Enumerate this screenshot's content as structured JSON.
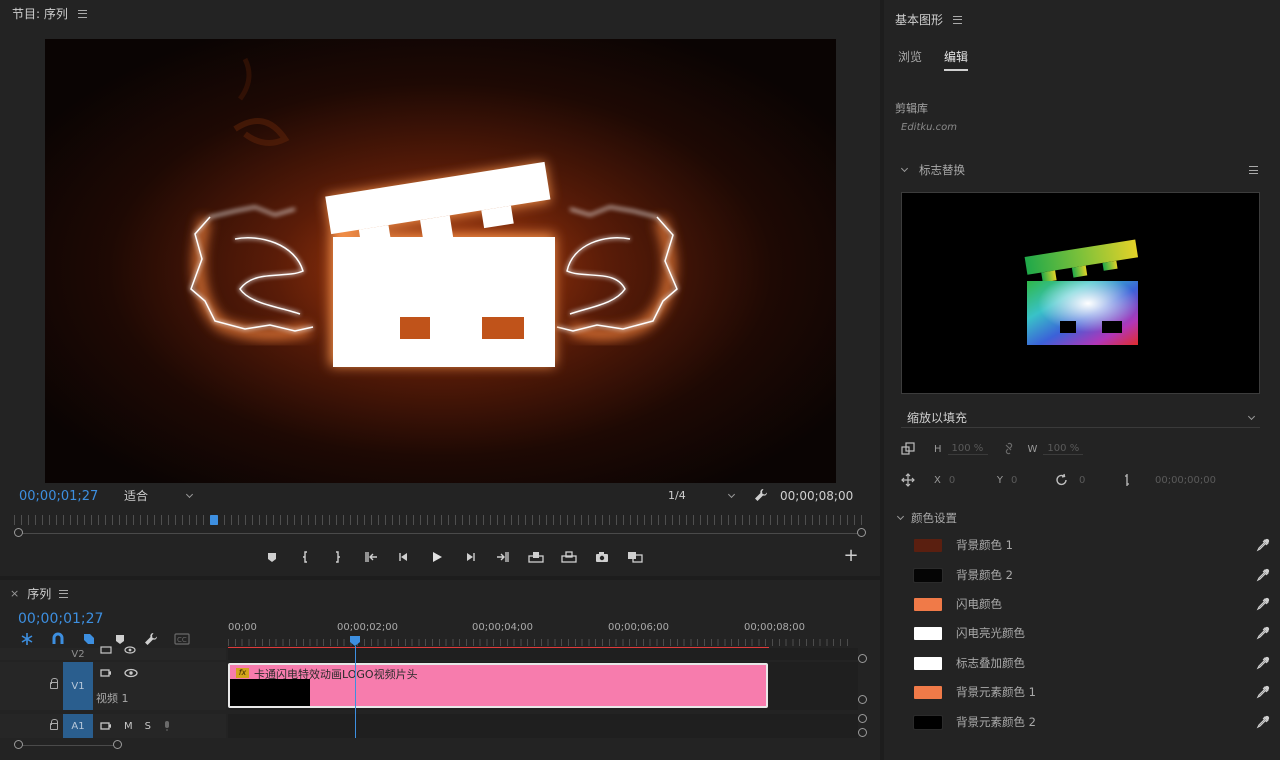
{
  "program": {
    "title": "节目: 序列",
    "timecode": "00;00;01;27",
    "fit": "适合",
    "resolution": "1/4",
    "duration": "00;00;08;00",
    "playhead_progress": 0.235
  },
  "timeline": {
    "title": "序列",
    "close": "×",
    "timecode": "00;00;01;27",
    "ruler": [
      "00;00",
      "00;00;02;00",
      "00;00;04;00",
      "00;00;06;00",
      "00;00;08;00"
    ],
    "tracks": {
      "v2": {
        "label": "V2"
      },
      "v1": {
        "label": "V1",
        "name": "视频 1"
      },
      "a1": {
        "label": "A1",
        "m": "M",
        "s": "S"
      }
    },
    "clip": {
      "fx": "fx",
      "name": "卡通闪电特效动画LOGO视频片头",
      "color": "#f77cad"
    }
  },
  "essential_graphics": {
    "title": "基本图形",
    "tabs": [
      {
        "label": "浏览",
        "active": false
      },
      {
        "label": "编辑",
        "active": true
      }
    ],
    "library": "剪辑库",
    "library_sub": "Editku.com",
    "section_logo": "标志替换",
    "scale_mode": "缩放以填充",
    "transform": {
      "h_label": "H",
      "h_value": "100 %",
      "w_label": "W",
      "w_value": "100 %",
      "x_label": "X",
      "x_value": "0",
      "y_label": "Y",
      "y_value": "0",
      "rot_value": "0",
      "time_value": "00;00;00;00"
    },
    "section_colors": "颜色设置",
    "colors": [
      {
        "name": "背景颜色 1",
        "hex": "#5a1f10"
      },
      {
        "name": "背景颜色 2",
        "hex": "#050505"
      },
      {
        "name": "闪电颜色",
        "hex": "#f07a48"
      },
      {
        "name": "闪电亮光颜色",
        "hex": "#ffffff"
      },
      {
        "name": "标志叠加颜色",
        "hex": "#ffffff"
      },
      {
        "name": "背景元素颜色 1",
        "hex": "#f07a48"
      },
      {
        "name": "背景元素颜色 2",
        "hex": "#000000"
      }
    ]
  },
  "icons": [
    "menu-icon",
    "wrench-icon",
    "marker-icon",
    "mark-in-icon",
    "mark-out-icon",
    "go-to-in-icon",
    "step-back-icon",
    "play-icon",
    "step-forward-icon",
    "go-to-out-icon",
    "lift-icon",
    "extract-icon",
    "camera-icon",
    "compare-icon",
    "add-icon",
    "eyedropper-icon",
    "lock-icon",
    "eye-icon",
    "mic-icon"
  ]
}
